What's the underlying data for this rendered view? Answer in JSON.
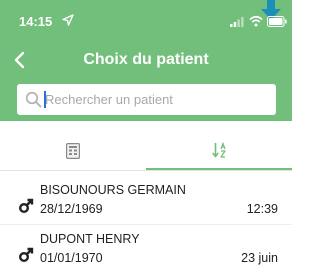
{
  "status_bar": {
    "time": "14:15",
    "icons": [
      "location-arrow-icon",
      "signal-icon",
      "wifi-icon",
      "battery-icon",
      "download-arrow-icon"
    ]
  },
  "header": {
    "title": "Choix du patient",
    "back_icon": "chevron-left-icon"
  },
  "search": {
    "placeholder": "Rechercher un patient",
    "value": "",
    "icon": "search-icon"
  },
  "tabs": [
    {
      "icon": "list-icon",
      "active": false
    },
    {
      "icon": "sort-alpha-icon",
      "active": true
    }
  ],
  "colors": {
    "accent": "#72bf7b",
    "header_text": "#ffffff",
    "placeholder": "#a8a8a8"
  },
  "patients": [
    {
      "name": "BISOUNOURS GERMAIN",
      "birthdate": "28/12/1969",
      "time": "12:39",
      "gender_icon": "male-icon"
    },
    {
      "name": "DUPONT HENRY",
      "birthdate": "01/01/1970",
      "time": "23 juin",
      "gender_icon": "male-icon"
    }
  ]
}
